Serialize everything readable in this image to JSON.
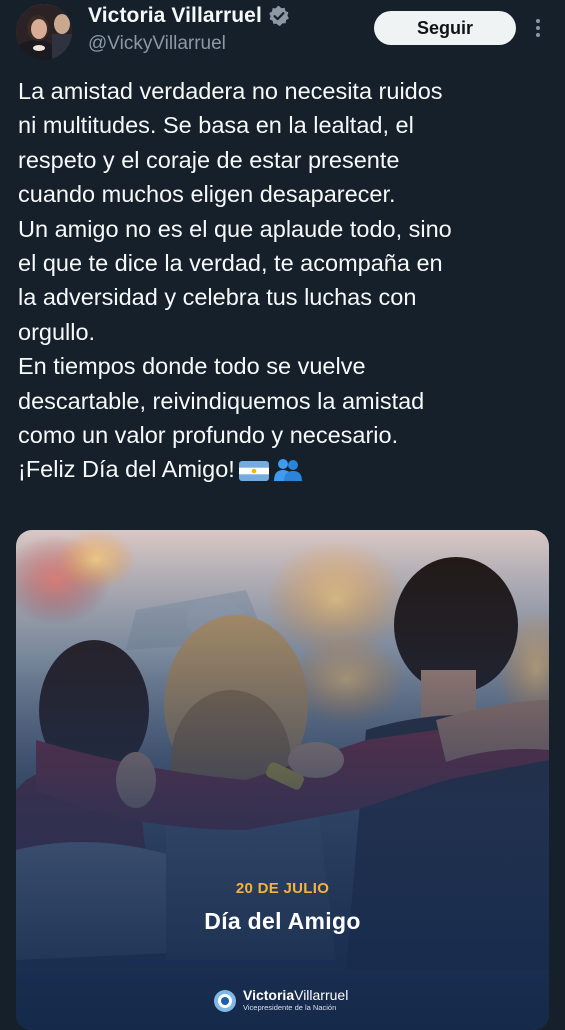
{
  "header": {
    "display_name": "Victoria Villarruel",
    "handle": "@VickyVillarruel",
    "follow_label": "Seguir"
  },
  "tweet": {
    "lines": [
      "La amistad verdadera no necesita ruidos",
      "ni multitudes. Se basa en la lealtad, el",
      "respeto y el coraje de estar presente",
      "cuando muchos eligen desaparecer.",
      "Un amigo no es el que aplaude todo, sino",
      "el que te dice la verdad, te acompaña en",
      "la adversidad y celebra tus luchas con",
      "orgullo.",
      "En tiempos donde todo se vuelve",
      "descartable, reivindiquemos la amistad",
      "como un valor profundo y necesario.",
      "¡Feliz Día del Amigo!"
    ],
    "emojis": [
      "flag-argentina-emoji",
      "two-people-emoji"
    ]
  },
  "media": {
    "date": "20 DE JULIO",
    "title": "Día del Amigo",
    "brand_name_bold": "Victoria",
    "brand_name_light": "Villarruel",
    "brand_subtitle": "Vicepresidente de la Nación"
  },
  "colors": {
    "background": "#15202b",
    "text": "#f7f9f9",
    "secondary_text": "#8b98a5",
    "verified_blue": "#1d9bf0",
    "follow_bg": "#eff3f4",
    "media_accent": "#f6b33a"
  }
}
